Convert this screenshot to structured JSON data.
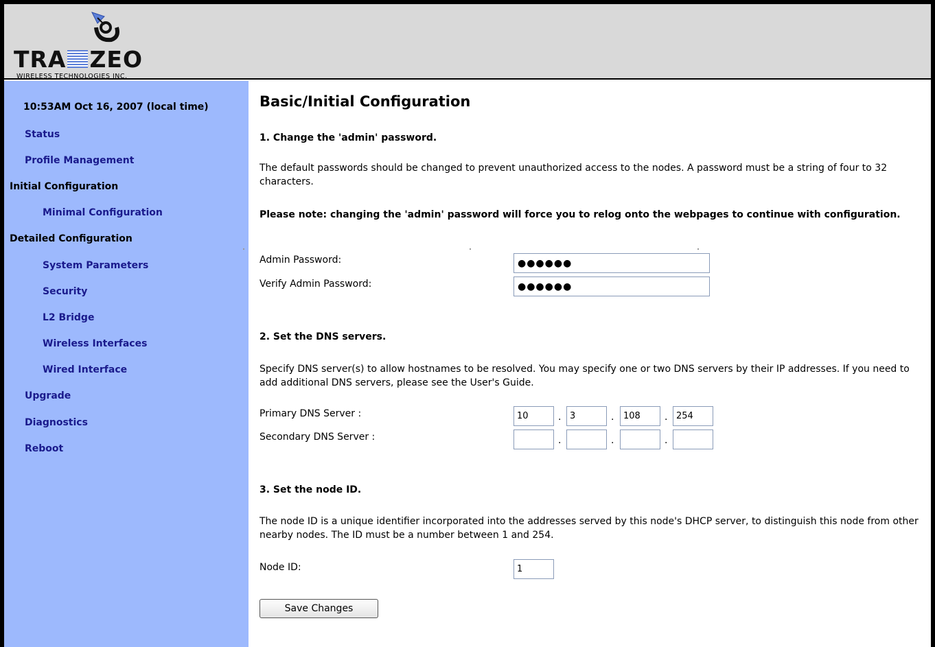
{
  "header": {
    "logo_word_left": "TRA",
    "logo_word_right": "ZEO",
    "logo_subtitle": "WIRELESS TECHNOLOGIES INC."
  },
  "sidebar": {
    "clock": "10:53AM Oct 16, 2007 (local time)",
    "items": [
      {
        "label": "Status"
      },
      {
        "label": "Profile Management"
      },
      {
        "label": "Initial Configuration"
      },
      {
        "label": "Minimal Configuration"
      },
      {
        "label": "Detailed Configuration"
      },
      {
        "label": "System Parameters"
      },
      {
        "label": "Security"
      },
      {
        "label": "L2 Bridge"
      },
      {
        "label": "Wireless Interfaces"
      },
      {
        "label": "Wired Interface"
      },
      {
        "label": "Upgrade"
      },
      {
        "label": "Diagnostics"
      },
      {
        "label": "Reboot"
      }
    ]
  },
  "main": {
    "title": "Basic/Initial Configuration",
    "section1": {
      "heading": "1. Change the 'admin' password.",
      "text": "The default passwords should be changed to prevent unauthorized access to the nodes. A password must be a string of four to 32 characters.",
      "note": "Please note: changing the 'admin' password will force you to relog onto the webpages to continue with configuration.",
      "admin_label": "Admin Password:",
      "admin_value": "●●●●●●",
      "verify_label": "Verify Admin Password:",
      "verify_value": "●●●●●●"
    },
    "section2": {
      "heading": "2. Set the DNS servers.",
      "text": "Specify DNS server(s) to allow hostnames to be resolved. You may specify one or two DNS servers by their IP addresses. If you need to add additional DNS servers, please see the User's Guide.",
      "primary_label": "Primary DNS Server :",
      "primary": [
        "10",
        "3",
        "108",
        "254"
      ],
      "secondary_label": "Secondary DNS Server :",
      "secondary": [
        "",
        "",
        "",
        ""
      ],
      "separator": "."
    },
    "section3": {
      "heading": "3. Set the node ID.",
      "text": "The node ID is a unique identifier incorporated into the addresses served by this node's DHCP server, to distinguish this node from other nearby nodes. The ID must be a number between 1 and 254.",
      "node_label": "Node ID:",
      "node_value": "1"
    },
    "save_label": "Save Changes"
  },
  "colors": {
    "sidebar_bg": "#9db9fd",
    "header_bg": "#d9d9d9",
    "nav_link": "#1a1a8c",
    "logo_accent": "#5d80d8"
  }
}
